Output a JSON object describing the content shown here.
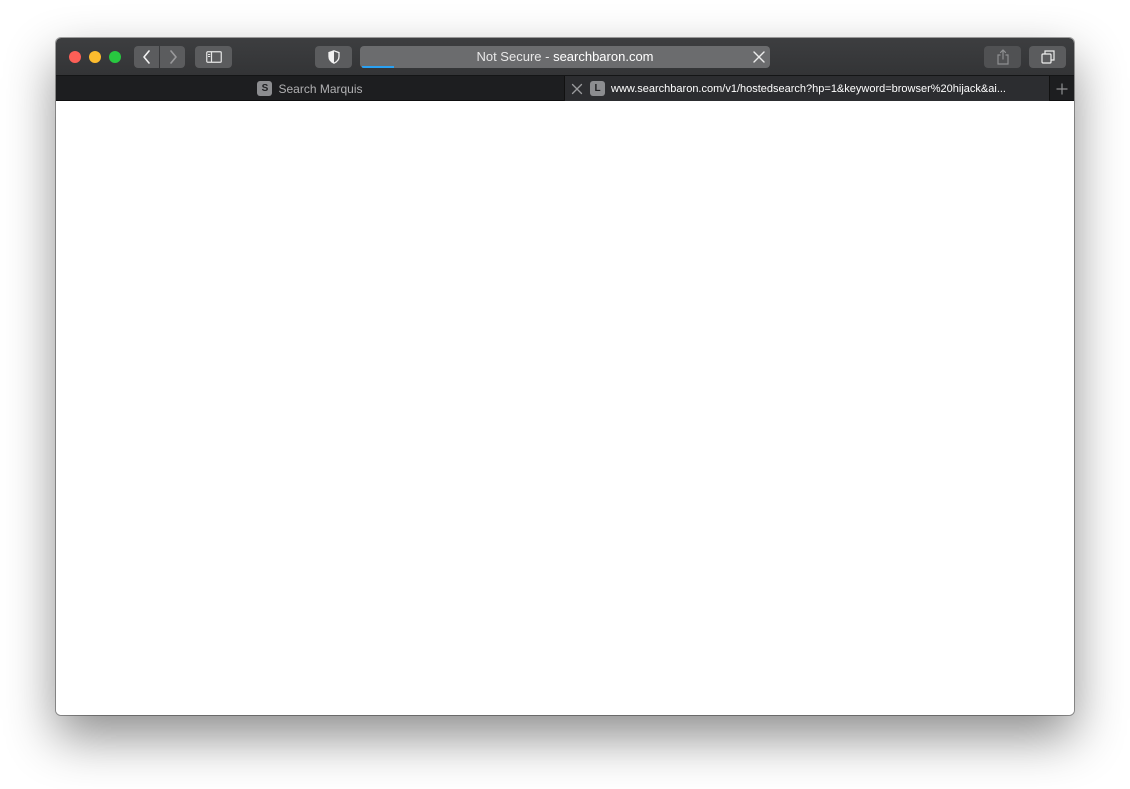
{
  "toolbar": {
    "address_prefix": "Not Secure - ",
    "address_domain": "searchbaron.com",
    "load_progress": 0.08
  },
  "tabs": [
    {
      "favicon_letter": "S",
      "title": "Search Marquis",
      "active": false
    },
    {
      "favicon_letter": "L",
      "title": "www.searchbaron.com/v1/hostedsearch?hp=1&keyword=browser%20hijack&ai...",
      "active": true
    }
  ],
  "icons": {
    "back": "chevron-left-icon",
    "forward": "chevron-right-icon",
    "sidebar": "sidebar-icon",
    "privacy": "shield-icon",
    "stop": "close-icon",
    "share": "share-icon",
    "tab_overview": "tab-overview-icon",
    "new_tab": "plus-icon"
  },
  "colors": {
    "close": "#fc5f57",
    "minimize": "#fdbc2e",
    "maximize": "#28c840",
    "progress": "#2aa1f3"
  }
}
